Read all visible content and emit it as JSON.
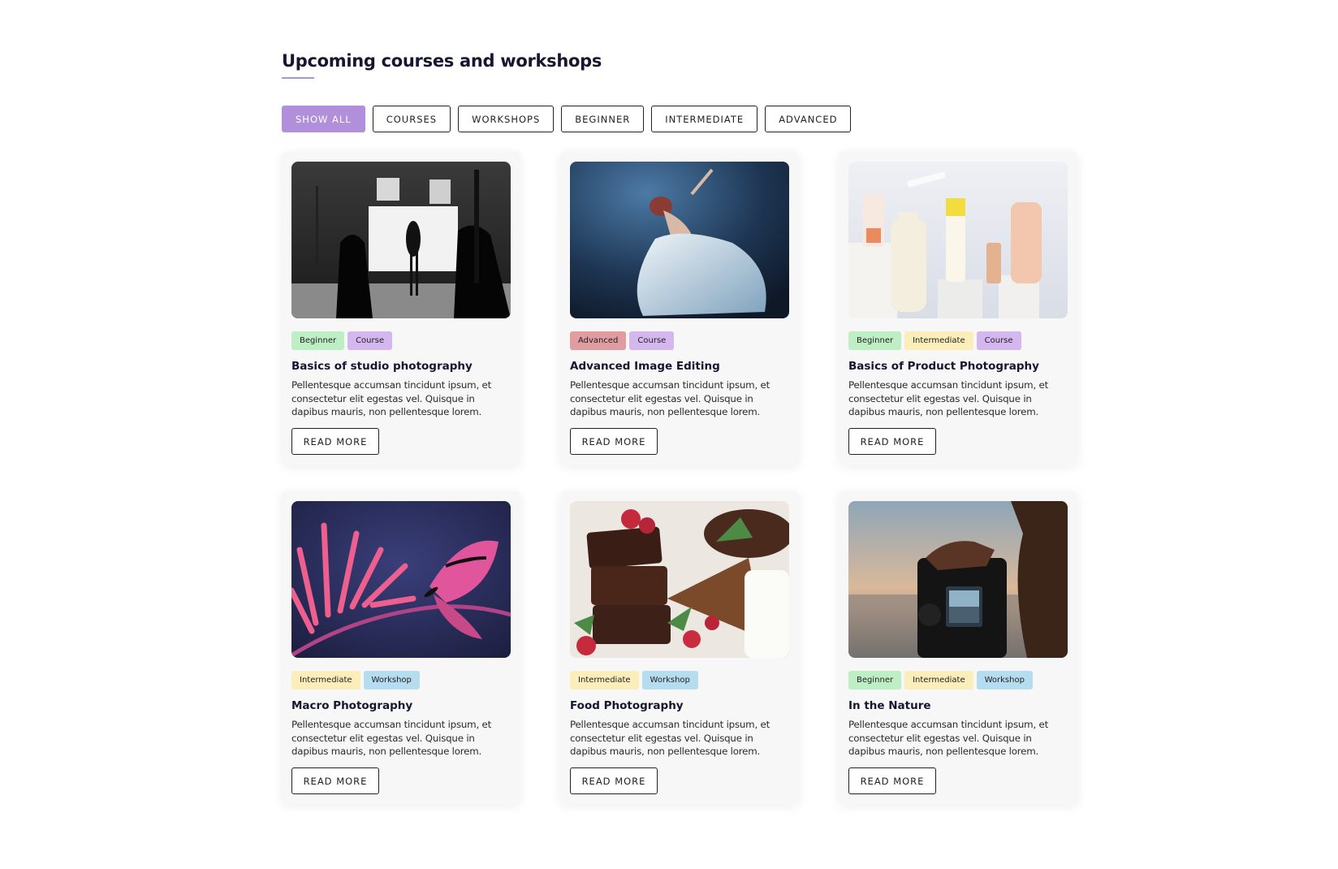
{
  "heading": "Upcoming courses and workshops",
  "filters": [
    "SHOW ALL",
    "COURSES",
    "WORKSHOPS",
    "BEGINNER",
    "INTERMEDIATE",
    "ADVANCED"
  ],
  "active_filter": "SHOW ALL",
  "colors": {
    "accent": "#b18fdb",
    "tag_beginner": "#bdeec4",
    "tag_intermediate": "#fbeeba",
    "tag_advanced": "#e19ca1",
    "tag_course": "#d5b7f0",
    "tag_workshop": "#b5dcef"
  },
  "cards": [
    {
      "image": "studio-photography-photo",
      "tags": [
        "Beginner",
        "Course"
      ],
      "title": "Basics of studio photography",
      "text": "Pellentesque accumsan tincidunt ipsum, et consectetur elit egestas vel. Quisque in dapibus mauris, non pellentesque lorem.",
      "button": "READ MORE"
    },
    {
      "image": "underwater-dress-photo",
      "tags": [
        "Advanced",
        "Course"
      ],
      "title": "Advanced Image Editing",
      "text": "Pellentesque accumsan tincidunt ipsum, et consectetur elit egestas vel. Quisque in dapibus mauris, non pellentesque lorem.",
      "button": "READ MORE"
    },
    {
      "image": "cosmetic-products-photo",
      "tags": [
        "Beginner",
        "Intermediate",
        "Course"
      ],
      "title": "Basics of Product Photography",
      "text": "Pellentesque accumsan tincidunt ipsum, et consectetur elit egestas vel. Quisque in dapibus mauris, non pellentesque lorem.",
      "button": "READ MORE"
    },
    {
      "image": "butterfly-macro-photo",
      "tags": [
        "Intermediate",
        "Workshop"
      ],
      "title": "Macro Photography",
      "text": "Pellentesque accumsan tincidunt ipsum, et consectetur elit egestas vel. Quisque in dapibus mauris, non pellentesque lorem.",
      "button": "READ MORE"
    },
    {
      "image": "brownie-food-photo",
      "tags": [
        "Intermediate",
        "Workshop"
      ],
      "title": "Food Photography",
      "text": "Pellentesque accumsan tincidunt ipsum, et consectetur elit egestas vel. Quisque in dapibus mauris, non pellentesque lorem.",
      "button": "READ MORE"
    },
    {
      "image": "camera-sunset-photo",
      "tags": [
        "Beginner",
        "Intermediate",
        "Workshop"
      ],
      "title": "In the Nature",
      "text": "Pellentesque accumsan tincidunt ipsum, et consectetur elit egestas vel. Quisque in dapibus mauris, non pellentesque lorem.",
      "button": "READ MORE"
    }
  ]
}
